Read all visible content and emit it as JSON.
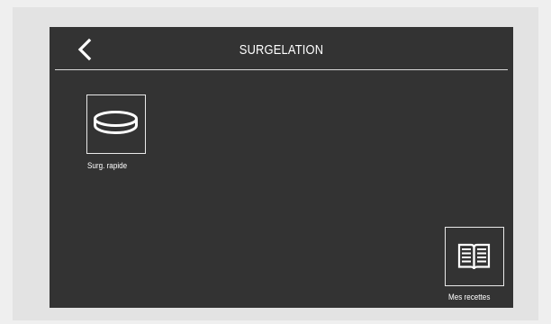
{
  "screen": {
    "title": "SURGELATION",
    "back_icon": "chevron-left-icon"
  },
  "programs": [
    {
      "label": "Surg. rapide",
      "icon": "plate-icon"
    }
  ],
  "footer": {
    "recipes_label": "Mes recettes",
    "recipes_icon": "open-book-icon"
  },
  "colors": {
    "screen_bg": "#333333",
    "text": "#ffffff",
    "outer_bg": "#efefef"
  }
}
